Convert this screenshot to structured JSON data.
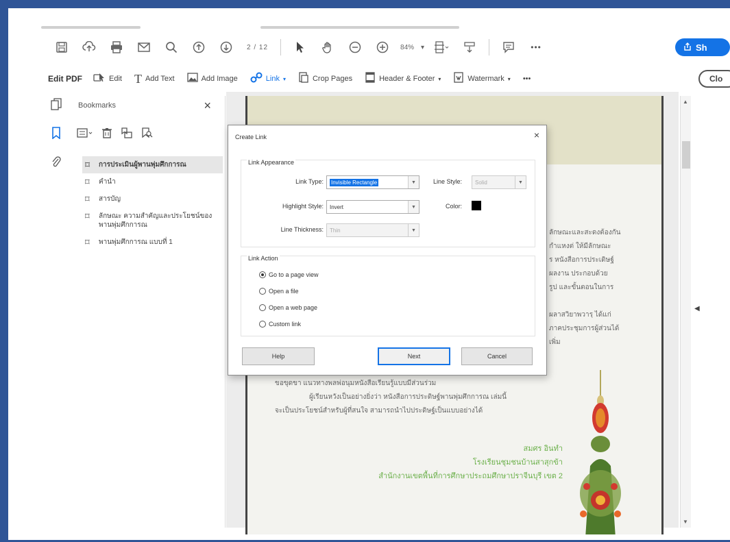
{
  "toolbar": {
    "page": "2 / 12",
    "zoom": "84%",
    "share_label": "Sh"
  },
  "edit_toolbar": {
    "title": "Edit PDF",
    "edit_label": "Edit",
    "add_text_label": "Add Text",
    "add_image_label": "Add Image",
    "link_label": "Link",
    "crop_label": "Crop Pages",
    "header_footer_label": "Header & Footer",
    "watermark_label": "Watermark",
    "more": "•••",
    "close_label": "Clo"
  },
  "bookmarks": {
    "title": "Bookmarks",
    "close": "×",
    "items": [
      "การประเมินผู้พานพุ่มศึกการณ",
      "คำนำ",
      "สารบัญ",
      "ลักษณะ ความสำคัญและประโยชน์ของพานพุ่มศึกการณ",
      "พานพุ่มศึกการณ แบบที่ 1"
    ]
  },
  "document": {
    "right_text": [
      "ลักษณะและสะดงต้องกัน",
      "กำแหงต่ ให้มีลักษณะ",
      "ร หนังสือการประเดิษฐ์",
      "ผลงาน ประกอบด้วย",
      "รูป และขั้นตอนในการ",
      "",
      "ผลาสวิยาพวารฺ ได้แก่",
      "ภาคประชุมการผู้ส่วนได้",
      "เพิ่ม"
    ],
    "body_text": [
      "ขอขุดขา แนวทางพลพ่อนุมหนังสือเรียนรู้แบบมีส่วนร่วม",
      "ผู้เรียนหวังเป็นอย่างยิ่งว่า หนังสือการประดิษฐ์พานพุ่มศึกการณ เล่มนี้",
      "จะเป็นประโยชน์สำหรับผู้ที่สนใจ สามารถนำไปประดิษฐ์เป็นแบบอย่างได้"
    ],
    "signature": [
      "สมศร อินทำ",
      "โรงเรียนชุมชนบ้านสาสุกข้า",
      "สำนักงานเขตพื้นที่การศึกษาประถมศึกษาปราจีนบุรี เขต 2"
    ]
  },
  "dialog": {
    "title": "Create Link",
    "close": "×",
    "appearance_title": "Link Appearance",
    "link_type_label": "Link Type:",
    "link_type_value": "Invisible Rectangle",
    "line_style_label": "Line Style:",
    "line_style_value": "Solid",
    "highlight_style_label": "Highlight Style:",
    "highlight_style_value": "Invert",
    "color_label": "Color:",
    "color_value": "#000000",
    "line_thickness_label": "Line Thickness:",
    "line_thickness_value": "Thin",
    "action_title": "Link Action",
    "actions": [
      "Go to a page view",
      "Open a file",
      "Open a web page",
      "Custom link"
    ],
    "selected_action": "Go to a page view",
    "help_label": "Help",
    "next_label": "Next",
    "cancel_label": "Cancel"
  },
  "colors": {
    "frame": "#2f5597",
    "accent": "#1473e6",
    "sign_green": "#6bb04a"
  }
}
